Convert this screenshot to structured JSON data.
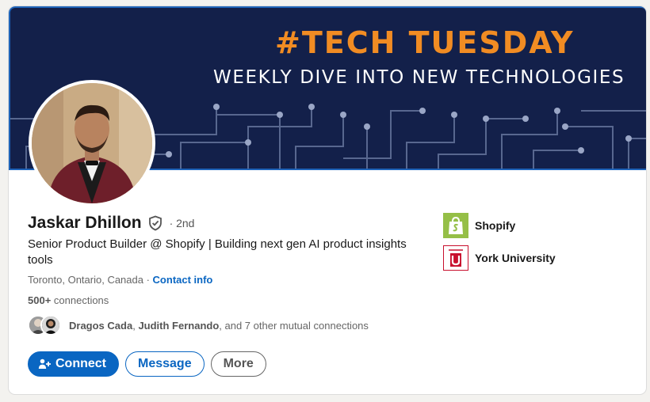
{
  "banner": {
    "title": "#TECH TUESDAY",
    "subtitle": "WEEKLY DIVE INTO NEW TECHNOLOGIES",
    "background": "#13204a",
    "accent": "#f18c23"
  },
  "profile": {
    "name": "Jaskar Dhillon",
    "verified_icon": "shield-check-icon",
    "degree": "· 2nd",
    "headline": "Senior Product Builder @ Shopify | Building next gen AI product insights tools",
    "location": "Toronto, Ontario, Canada",
    "separator": " · ",
    "contact_info": "Contact info",
    "connections_count": "500+",
    "connections_label": " connections"
  },
  "mutual": {
    "name1": "Dragos Cada",
    "comma": ", ",
    "name2": "Judith Fernando",
    "rest": ", and 7 other mutual connections"
  },
  "actions": {
    "connect": "Connect",
    "message": "Message",
    "more": "More"
  },
  "organizations": [
    {
      "name": "Shopify",
      "logo": "shopify-bag-icon"
    },
    {
      "name": "York University",
      "logo": "york-university-icon"
    }
  ],
  "colors": {
    "link": "#0a66c2",
    "shopify": "#95bf47",
    "york": "#c8102e"
  }
}
